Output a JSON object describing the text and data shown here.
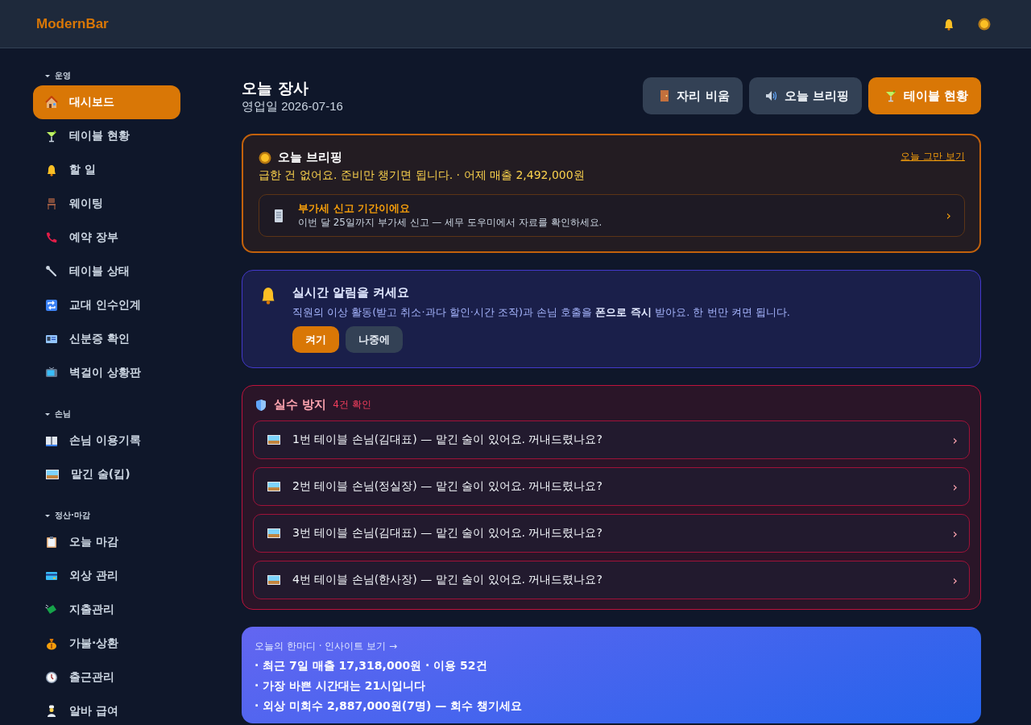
{
  "header": {
    "brand": "ModernBar"
  },
  "sidebar": {
    "sections": [
      {
        "title": "운영",
        "expanded": true,
        "items": [
          {
            "label": "대시보드",
            "selected": true
          },
          {
            "label": "테이블 현황",
            "selected": false
          },
          {
            "label": "할 일",
            "selected": false
          },
          {
            "label": "웨이팅",
            "selected": false
          },
          {
            "label": "예약 장부",
            "selected": false
          },
          {
            "label": "테이블 상태",
            "selected": false
          },
          {
            "label": "교대 인수인계",
            "selected": false
          },
          {
            "label": "신분증 확인",
            "selected": false
          },
          {
            "label": "벽걸이 상황판",
            "selected": false
          }
        ]
      },
      {
        "title": "손님",
        "expanded": true,
        "items": [
          {
            "label": "손님 이용기록",
            "selected": false
          },
          {
            "label": "맡긴 술(킵)",
            "selected": false
          }
        ]
      },
      {
        "title": "정산·마감",
        "expanded": true,
        "items": [
          {
            "label": "오늘 마감",
            "selected": false
          },
          {
            "label": "외상 관리",
            "selected": false
          },
          {
            "label": "지출관리",
            "selected": false
          },
          {
            "label": "가불·상환",
            "selected": false
          },
          {
            "label": "출근관리",
            "selected": false
          },
          {
            "label": "알바 급여",
            "selected": false
          }
        ]
      }
    ]
  },
  "page": {
    "title": "오늘 장사",
    "subtitle": "영업일 2026-07-16",
    "actions": [
      {
        "label": "자리 비움",
        "primary": false
      },
      {
        "label": "오늘 브리핑",
        "primary": false
      },
      {
        "label": "테이블 현황",
        "primary": true
      }
    ]
  },
  "briefing": {
    "title": "오늘 브리핑",
    "dismiss": "오늘 그만 보기",
    "summary": "급한 건 없어요. 준비만 챙기면 됩니다. · 어제 매출 2,492,000원",
    "notice": {
      "title": "부가세 신고 기간이에요",
      "text": "이번 달 25일까지 부가세 신고 — 세무 도우미에서 자료를 확인하세요.",
      "chevron": "›"
    }
  },
  "alerts": {
    "title": "실시간 알림을 켜세요",
    "text": "직원의 이상 활동(받고 취소·과다 할인·시간 조작)과 손님 호출을 **폰으로 즉시** 받아요. 한 번만 켜면 됩니다.",
    "buttons": [
      {
        "label": "켜기",
        "primary": true
      },
      {
        "label": "나중에",
        "primary": false
      }
    ]
  },
  "mistakes": {
    "title": "실수 방지",
    "count": "4건 확인",
    "rows": [
      {
        "text": "1번 테이블 손님(김대표) — 맡긴 술이 있어요. 꺼내드렸나요?",
        "chevron": "›"
      },
      {
        "text": "2번 테이블 손님(정실장) — 맡긴 술이 있어요. 꺼내드렸나요?",
        "chevron": "›"
      },
      {
        "text": "3번 테이블 손님(김대표) — 맡긴 술이 있어요. 꺼내드렸나요?",
        "chevron": "›"
      },
      {
        "text": "4번 테이블 손님(한사장) — 맡긴 술이 있어요. 꺼내드렸나요?",
        "chevron": "›"
      }
    ]
  },
  "insight": {
    "link": "오늘의 한마디 · 인사이트 보기 →",
    "lines": [
      "· 최근 7일 매출 17,318,000원 · 이용 52건",
      "· 가장 바쁜 시간대는 21시입니다",
      "· 외상 미회수 2,887,000원(7명) — 회수 챙기세요"
    ]
  }
}
